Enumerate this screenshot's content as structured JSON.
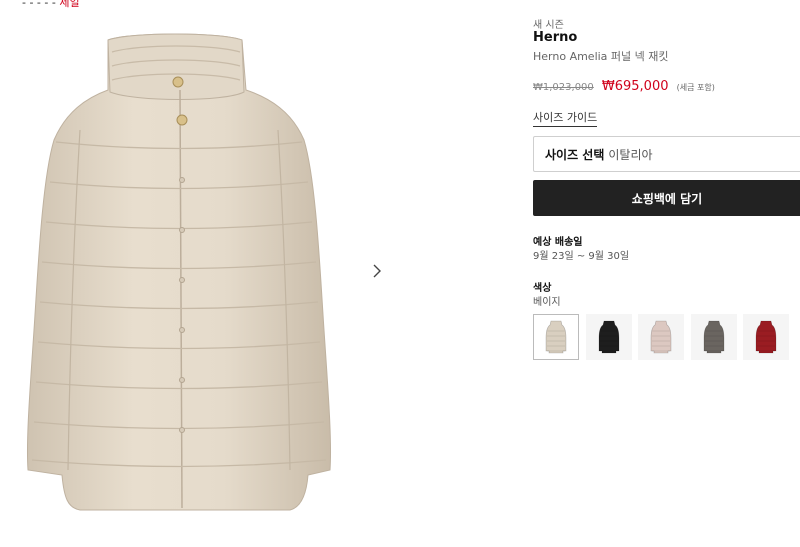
{
  "breadcrumb": {
    "text": "- - - - -",
    "tag": "세일"
  },
  "product": {
    "season": "새 시즌",
    "brand": "Herno",
    "name": "Herno Amelia 퍼널 넥 재킷",
    "original_price": "₩1,023,000",
    "sale_price": "₩695,000",
    "tax_note": "(세금 포함)"
  },
  "size_guide_label": "사이즈 가이드",
  "size_select": {
    "label": "사이즈 선택",
    "value": "이탈리아"
  },
  "add_to_bag_label": "쇼핑백에 담기",
  "shipping": {
    "title": "예상 배송일",
    "date_range": "9월 23일 ~ 9월 30일"
  },
  "color": {
    "title": "색상",
    "selected": "베이지"
  },
  "swatches": [
    {
      "color": "#d9cfc0",
      "icon": "jacket-beige-icon",
      "selected": true
    },
    {
      "color": "#1e1e1e",
      "icon": "jacket-black-icon",
      "selected": false
    },
    {
      "color": "#dcc8c1",
      "icon": "jacket-pink-icon",
      "selected": false
    },
    {
      "color": "#6a6560",
      "icon": "jacket-grey-icon",
      "selected": false
    },
    {
      "color": "#9a1c22",
      "icon": "jacket-red-icon",
      "selected": false
    }
  ],
  "icons": {
    "next": "chevron-right-icon"
  },
  "colors": {
    "price_sale": "#d0021b",
    "button_bg": "#222222",
    "jacket_main": "#ddd2c2"
  }
}
